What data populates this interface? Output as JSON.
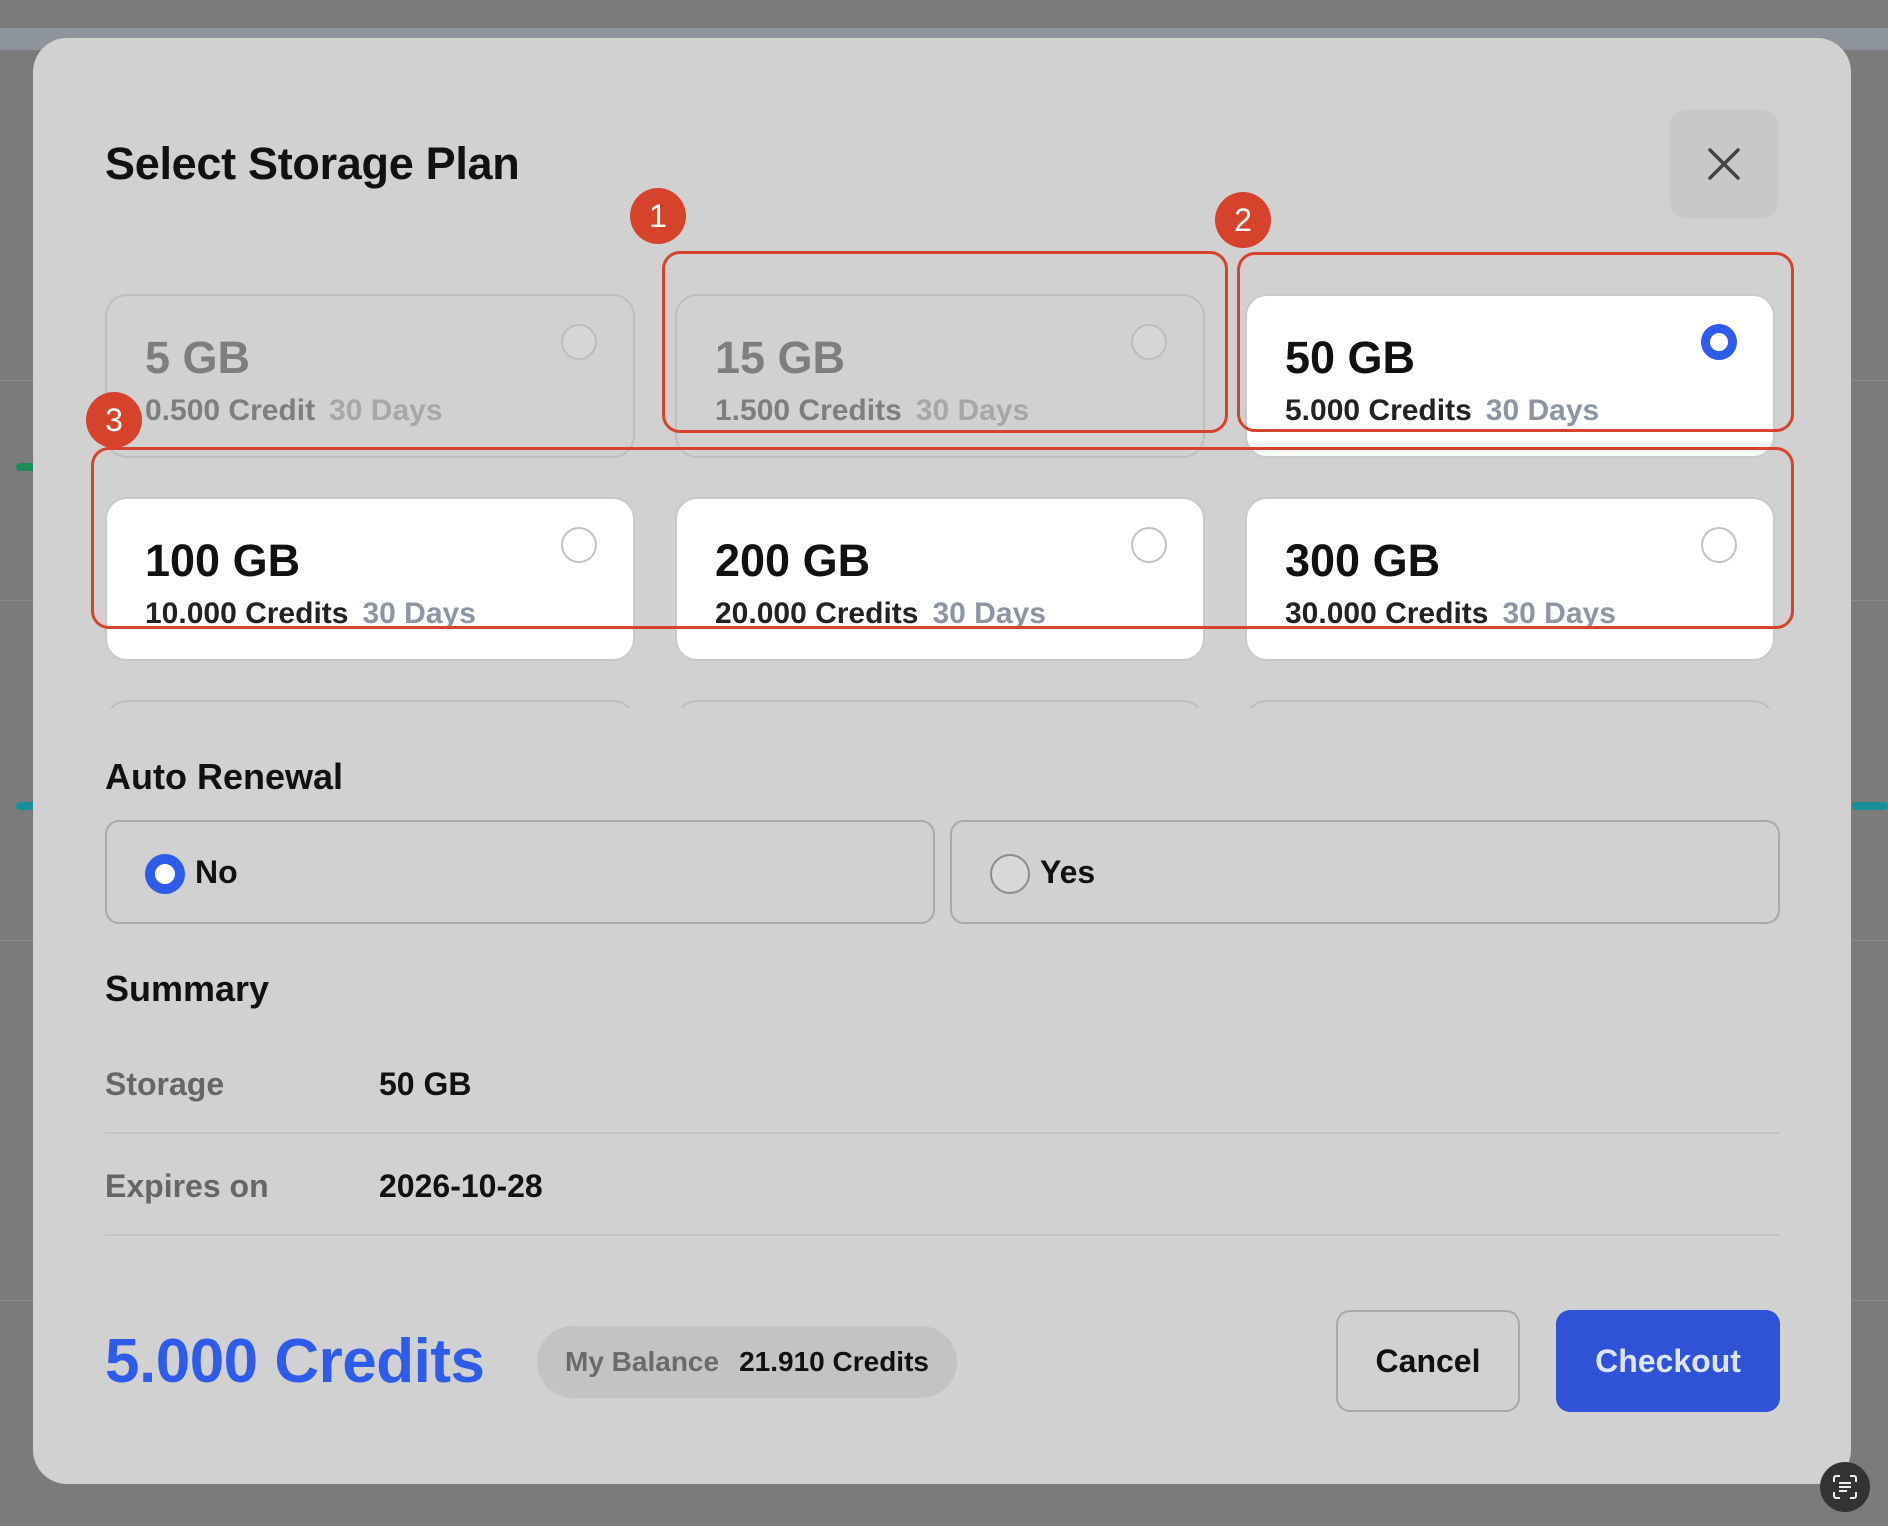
{
  "modal": {
    "title": "Select Storage Plan",
    "close_icon": "close-icon"
  },
  "plans": [
    {
      "size": "5 GB",
      "credits": "0.500 Credit",
      "duration": "30 Days",
      "state": "disabled"
    },
    {
      "size": "15 GB",
      "credits": "1.500 Credits",
      "duration": "30 Days",
      "state": "disabled"
    },
    {
      "size": "50 GB",
      "credits": "5.000 Credits",
      "duration": "30 Days",
      "state": "selected"
    },
    {
      "size": "100 GB",
      "credits": "10.000 Credits",
      "duration": "30 Days",
      "state": "available"
    },
    {
      "size": "200 GB",
      "credits": "20.000 Credits",
      "duration": "30 Days",
      "state": "available"
    },
    {
      "size": "300 GB",
      "credits": "30.000 Credits",
      "duration": "30 Days",
      "state": "available"
    },
    {
      "size": "",
      "credits": "",
      "duration": "",
      "state": "available"
    },
    {
      "size": "",
      "credits": "",
      "duration": "",
      "state": "available"
    },
    {
      "size": "",
      "credits": "",
      "duration": "",
      "state": "available"
    }
  ],
  "annotations": [
    "1",
    "2",
    "3"
  ],
  "auto_renewal": {
    "label": "Auto Renewal",
    "options": [
      {
        "label": "No",
        "selected": true
      },
      {
        "label": "Yes",
        "selected": false
      }
    ]
  },
  "summary": {
    "label": "Summary",
    "rows": [
      {
        "key": "Storage",
        "value": "50 GB"
      },
      {
        "key": "Expires on",
        "value": "2026-10-28"
      }
    ]
  },
  "footer": {
    "total": "5.000 Credits",
    "balance_label": "My Balance",
    "balance_value": "21.910 Credits",
    "cancel_label": "Cancel",
    "checkout_label": "Checkout"
  },
  "colors": {
    "accent": "#2f5bea",
    "annotation": "#d6432d",
    "overlay": "#7b7b7b"
  }
}
